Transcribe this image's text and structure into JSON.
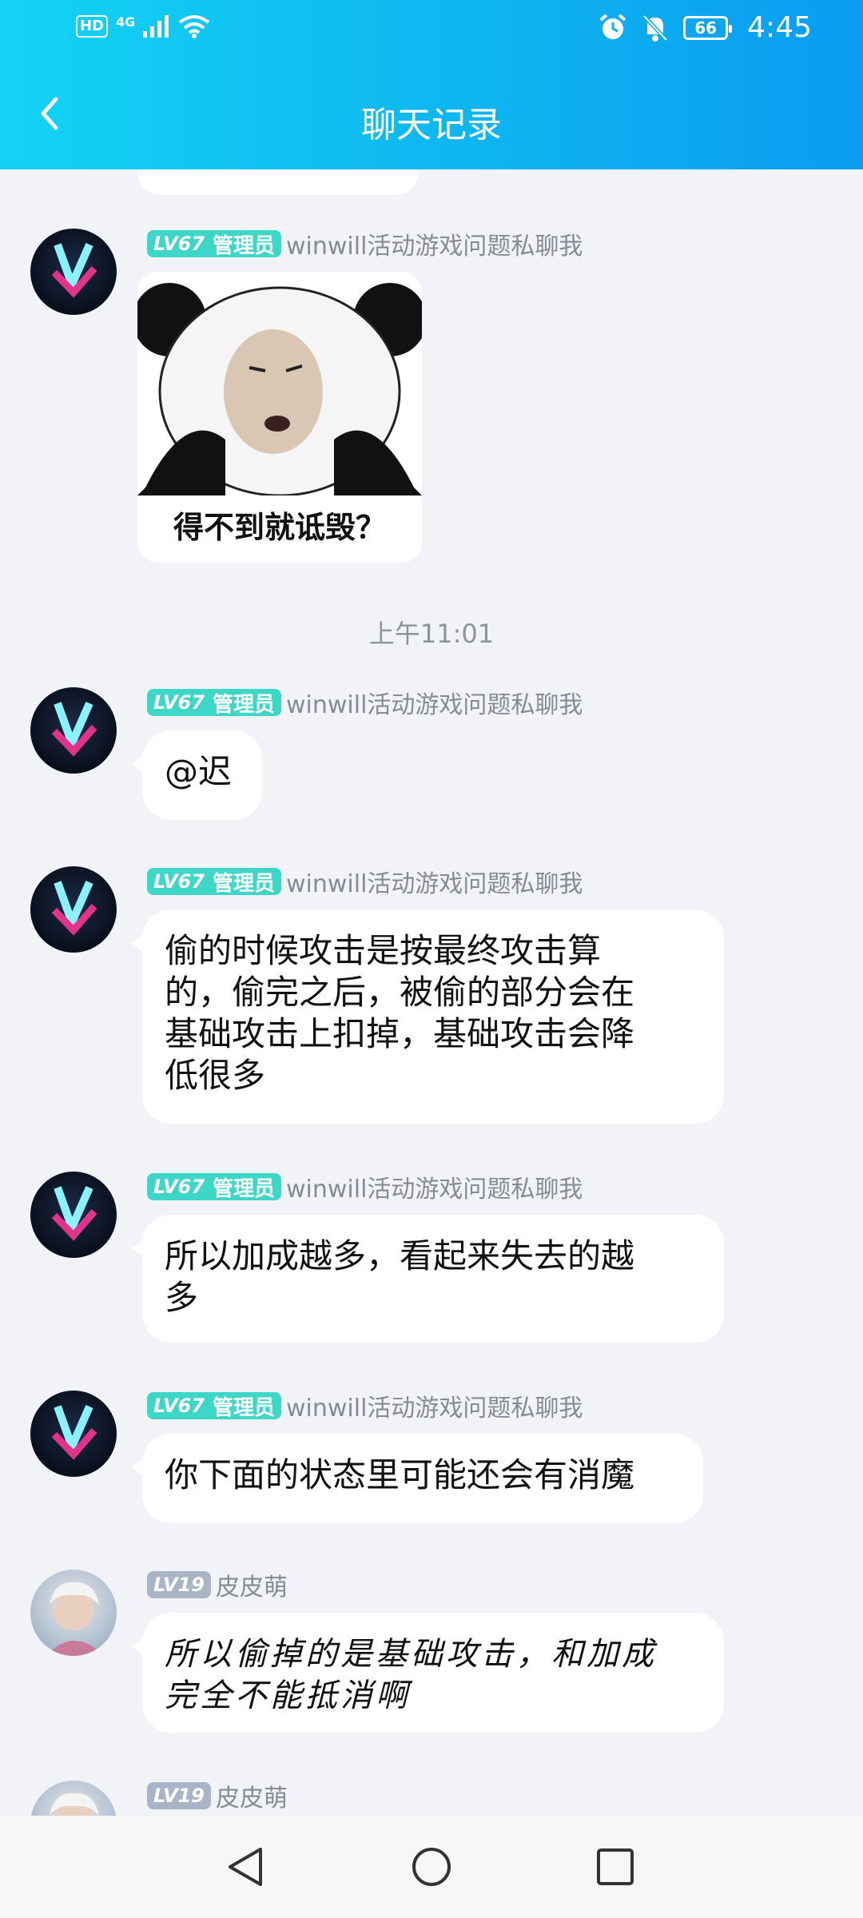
{
  "status_bar": {
    "network": "4G",
    "hd": "HD",
    "battery": "66",
    "time": "4:45"
  },
  "header": {
    "title": "聊天记录"
  },
  "messages": [
    {
      "sender_level": "LV67",
      "sender_role": "管理员",
      "sender_name": "winwill活动游戏问题私聊我",
      "type": "sticker",
      "sticker_caption": "得不到就诋毁？"
    },
    {
      "type": "timestamp",
      "text": "上午11:01"
    },
    {
      "sender_level": "LV67",
      "sender_role": "管理员",
      "sender_name": "winwill活动游戏问题私聊我",
      "text": "@迟"
    },
    {
      "sender_level": "LV67",
      "sender_role": "管理员",
      "sender_name": "winwill活动游戏问题私聊我",
      "text_lines": [
        "偷的时候攻击是按最终攻击算",
        "的，偷完之后，被偷的部分会在",
        "基础攻击上扣掉，基础攻击会降",
        "低很多"
      ]
    },
    {
      "sender_level": "LV67",
      "sender_role": "管理员",
      "sender_name": "winwill活动游戏问题私聊我",
      "text_lines": [
        "所以加成越多，看起来失去的越",
        "多"
      ]
    },
    {
      "sender_level": "LV67",
      "sender_role": "管理员",
      "sender_name": "winwill活动游戏问题私聊我",
      "text": "你下面的状态里可能还会有消魔"
    },
    {
      "sender_level": "LV19",
      "sender_name": "皮皮萌",
      "text_lines": [
        "所以偷掉的是基础攻击，和加成",
        "完全不能抵消啊"
      ]
    },
    {
      "sender_level": "LV19",
      "sender_name": "皮皮萌"
    }
  ],
  "nav": {
    "back": "back-icon",
    "home": "home-icon",
    "recent": "recent-apps-icon"
  }
}
